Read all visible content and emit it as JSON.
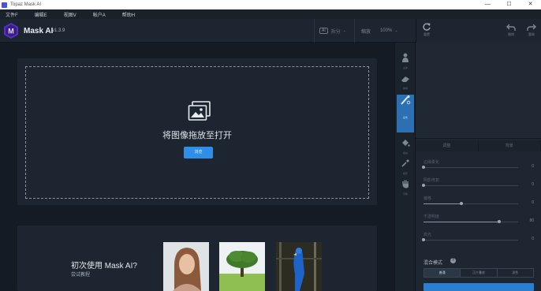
{
  "window": {
    "title": "Topaz Mask AI",
    "controls": [
      "—",
      "☐",
      "✕"
    ]
  },
  "menu": [
    "文件F",
    "编辑E",
    "视图V",
    "帐户A",
    "帮助H"
  ],
  "header": {
    "app_name": "Mask AI",
    "version": "v1.3.9",
    "ai_badge": "AI",
    "split_label": "拆分",
    "zoom_label": "缩放",
    "zoom_value": "100%",
    "chevron": "⌄"
  },
  "right_header": {
    "buttons": [
      {
        "icon": "refresh-icon",
        "label": "重置"
      },
      {
        "icon": "undo-icon",
        "label": "撤销"
      },
      {
        "icon": "redo-icon",
        "label": "重做"
      }
    ]
  },
  "canvas": {
    "drop_text": "将图像拖放至打开",
    "open_button": "浏览"
  },
  "intro": {
    "title": "初次使用 Mask AI?",
    "subtitle": "尝试教程",
    "thumbnails": [
      "portrait-photo",
      "tree-photo",
      "parrot-photo"
    ]
  },
  "tools": [
    {
      "icon": "person-icon",
      "label": "主体"
    },
    {
      "icon": "eraser-icon",
      "label": "擦除"
    },
    {
      "icon": "brush-icon",
      "label": "画笔",
      "active": true
    },
    {
      "icon": "fill-icon",
      "label": "填充"
    },
    {
      "icon": "eyedropper-icon",
      "label": "吸管"
    },
    {
      "icon": "hand-icon",
      "label": "平移"
    }
  ],
  "panel": {
    "tabs": [
      "调整",
      "背景"
    ],
    "sliders": [
      {
        "label": "边缘柔化",
        "value": "0",
        "level": 0.0
      },
      {
        "label": "阴影修复",
        "value": "0",
        "level": 0.0
      },
      {
        "label": "偏移",
        "value": "0",
        "level": 0.4
      },
      {
        "label": "不透明度",
        "value": "80",
        "level": 0.8
      },
      {
        "label": "高光",
        "value": "0",
        "level": 0.0
      }
    ],
    "blend_label": "混合模式",
    "blend_tabs": [
      "普通",
      "正片叠底",
      "滤色"
    ],
    "help": "?"
  },
  "colors": {
    "accent": "#2f8fe6",
    "active_tool": "#2c6fb3",
    "logo": "#6b3bd6"
  }
}
